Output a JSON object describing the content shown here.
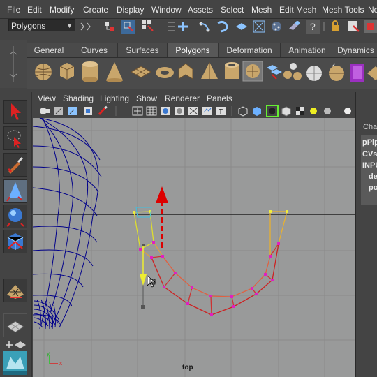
{
  "menubar": {
    "items": [
      "File",
      "Edit",
      "Modify",
      "Create",
      "Display",
      "Window",
      "Assets",
      "Select",
      "Mesh",
      "Edit Mesh",
      "Mesh Tools",
      "No"
    ]
  },
  "status_line": {
    "mode": "Polygons"
  },
  "shelf": {
    "tabs": [
      "General",
      "Curves",
      "Surfaces",
      "Polygons",
      "Deformation",
      "Animation",
      "Dynamics"
    ],
    "active_tab": "Polygons"
  },
  "panel": {
    "menu": [
      "View",
      "Shading",
      "Lighting",
      "Show",
      "Renderer",
      "Panels"
    ],
    "view_name": "top"
  },
  "channel_box": {
    "header": "Cha",
    "lines": [
      "pPip",
      "CVs",
      "INPU",
      "de",
      "po"
    ]
  },
  "colors": {
    "viewport_bg": "#999a9a",
    "wireframe": "#00008a",
    "pipe_yellow": "#e8e840",
    "pipe_red": "#cc2222",
    "arrow_red": "#dd0000"
  }
}
